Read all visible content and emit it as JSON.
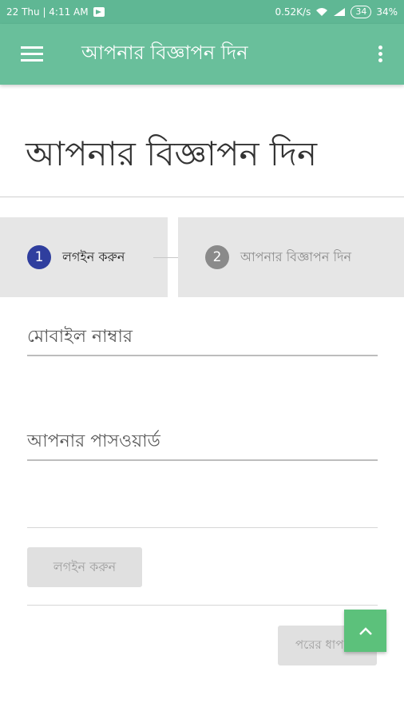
{
  "status_bar": {
    "date_time": "22 Thu | 4:11 AM",
    "network_speed": "0.52K/s",
    "battery_level": "34",
    "battery_percent": "34%"
  },
  "app_bar": {
    "title": "আপনার বিজ্ঞাপন দিন",
    "menu_icon": "hamburger-menu-icon",
    "overflow_icon": "more-vert-icon"
  },
  "page": {
    "title": "আপনার বিজ্ঞাপন দিন"
  },
  "stepper": {
    "steps": [
      {
        "number": "1",
        "label": "লগইন করুন",
        "active": true
      },
      {
        "number": "2",
        "label": "আপনার বিজ্ঞাপন দিন",
        "active": false
      }
    ]
  },
  "form": {
    "mobile_placeholder": "মোবাইল নাম্বার",
    "password_placeholder": "আপনার পাসওয়ার্ড",
    "login_button": "লগইন করুন",
    "next_button": "পরের ধাপ"
  },
  "colors": {
    "accent": "#69bf9b",
    "step_active": "#2f3e9e",
    "fab": "#5cc17b"
  }
}
